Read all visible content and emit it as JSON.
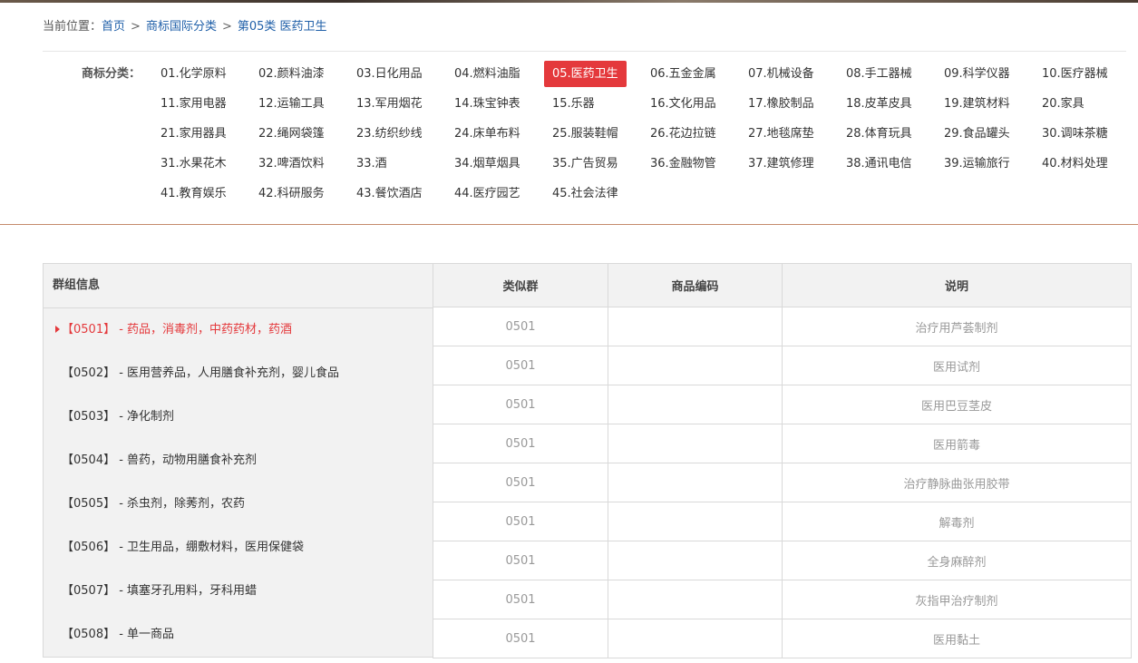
{
  "breadcrumb": {
    "label": "当前位置：",
    "items": [
      "首页",
      "商标国际分类",
      "第05类 医药卫生"
    ],
    "separator": ">"
  },
  "categories": {
    "label": "商标分类：",
    "active_index": 4,
    "items": [
      "01.化学原料",
      "02.颜料油漆",
      "03.日化用品",
      "04.燃料油脂",
      "05.医药卫生",
      "06.五金金属",
      "07.机械设备",
      "08.手工器械",
      "09.科学仪器",
      "10.医疗器械",
      "11.家用电器",
      "12.运输工具",
      "13.军用烟花",
      "14.珠宝钟表",
      "15.乐器",
      "16.文化用品",
      "17.橡胶制品",
      "18.皮革皮具",
      "19.建筑材料",
      "20.家具",
      "21.家用器具",
      "22.绳网袋篷",
      "23.纺织纱线",
      "24.床单布料",
      "25.服装鞋帽",
      "26.花边拉链",
      "27.地毯席垫",
      "28.体育玩具",
      "29.食品罐头",
      "30.调味茶糖",
      "31.水果花木",
      "32.啤酒饮料",
      "33.酒",
      "34.烟草烟具",
      "35.广告贸易",
      "36.金融物管",
      "37.建筑修理",
      "38.通讯电信",
      "39.运输旅行",
      "40.材料处理",
      "41.教育娱乐",
      "42.科研服务",
      "43.餐饮酒店",
      "44.医疗园艺",
      "45.社会法律"
    ]
  },
  "groups": {
    "header": "群组信息",
    "active_index": 0,
    "items": [
      "【0501】 - 药品，消毒剂，中药药材，药酒",
      "【0502】 - 医用营养品，人用膳食补充剂，婴儿食品",
      "【0503】 - 净化制剂",
      "【0504】 - 兽药，动物用膳食补充剂",
      "【0505】 - 杀虫剂，除莠剂，农药",
      "【0506】 - 卫生用品，绷敷材料，医用保健袋",
      "【0507】 - 填塞牙孔用料，牙科用蜡",
      "【0508】 - 单一商品"
    ]
  },
  "table": {
    "headers": [
      "类似群",
      "商品编码",
      "说明"
    ],
    "rows": [
      [
        "0501",
        "",
        "治疗用芦荟制剂"
      ],
      [
        "0501",
        "",
        "医用试剂"
      ],
      [
        "0501",
        "",
        "医用巴豆茎皮"
      ],
      [
        "0501",
        "",
        "医用箭毒"
      ],
      [
        "0501",
        "",
        "治疗静脉曲张用胶带"
      ],
      [
        "0501",
        "",
        "解毒剂"
      ],
      [
        "0501",
        "",
        "全身麻醉剂"
      ],
      [
        "0501",
        "",
        "灰指甲治疗制剂"
      ],
      [
        "0501",
        "",
        "医用黏土"
      ]
    ]
  },
  "colors": {
    "accent": "#e4393c",
    "link": "#1f5fa8",
    "divider": "#c58a6b"
  }
}
